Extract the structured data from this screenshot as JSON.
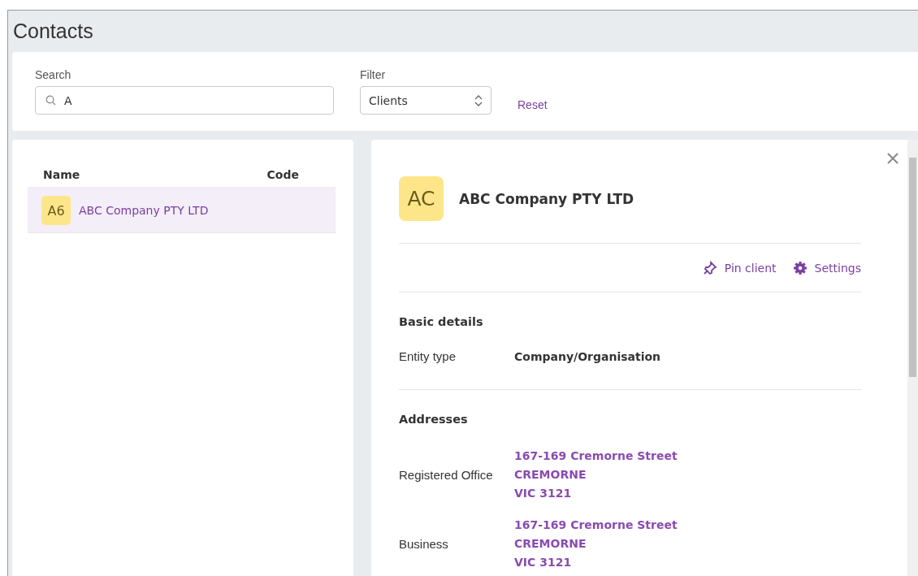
{
  "page": {
    "title": "Contacts"
  },
  "search": {
    "label": "Search",
    "value": "A"
  },
  "filter": {
    "label": "Filter",
    "value": "Clients"
  },
  "reset": "Reset",
  "list": {
    "columns": [
      "Name",
      "Code"
    ],
    "rows": [
      {
        "avatar": "A6",
        "name": "ABC Company PTY LTD",
        "selected": true
      }
    ]
  },
  "detail": {
    "avatar": "AC",
    "name": "ABC Company PTY LTD",
    "actions": [
      {
        "kind": "pin",
        "label": "Pin client"
      },
      {
        "kind": "settings",
        "label": "Settings"
      }
    ],
    "basic": {
      "heading": "Basic details",
      "fields": [
        {
          "label": "Entity type",
          "value": "Company/Organisation"
        }
      ]
    },
    "addresses": {
      "heading": "Addresses",
      "items": [
        {
          "label": "Registered Office",
          "lines": [
            "167-169 Cremorne Street",
            "CREMORNE",
            "VIC 3121"
          ]
        },
        {
          "label": "Business",
          "lines": [
            "167-169 Cremorne Street",
            "CREMORNE",
            "VIC 3121"
          ]
        }
      ]
    }
  }
}
